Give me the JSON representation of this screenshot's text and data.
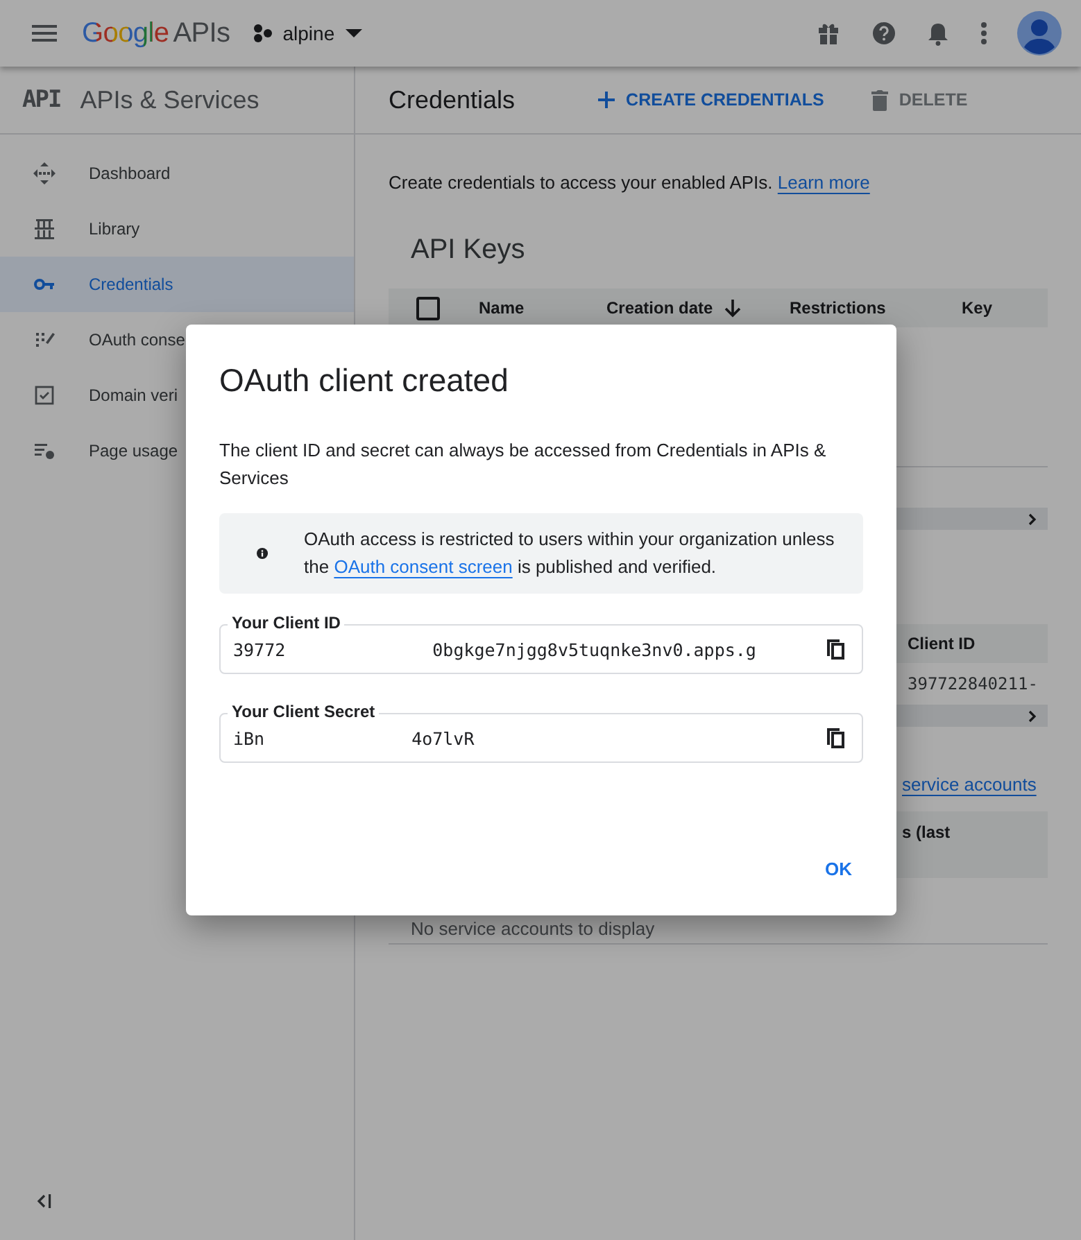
{
  "header": {
    "logo": {
      "letters": "Google",
      "suffix": "APIs"
    },
    "project": "alpine"
  },
  "subheader": {
    "product_mark": "API",
    "product": "APIs & Services",
    "page_title": "Credentials",
    "actions": [
      {
        "kind": "create",
        "label": "CREATE CREDENTIALS",
        "disabled": false
      },
      {
        "kind": "delete",
        "label": "DELETE",
        "disabled": true
      }
    ]
  },
  "sidebar": {
    "items": [
      {
        "kind": "dashboard",
        "label": "Dashboard",
        "selected": false
      },
      {
        "kind": "library",
        "label": "Library",
        "selected": false
      },
      {
        "kind": "key",
        "label": "Credentials",
        "selected": true
      },
      {
        "kind": "consent",
        "label": "OAuth conse",
        "selected": false
      },
      {
        "kind": "domain",
        "label": "Domain veri",
        "selected": false
      },
      {
        "kind": "usage",
        "label": "Page usage",
        "selected": false
      }
    ]
  },
  "main": {
    "intro": "Create credentials to access your enabled APIs.",
    "intro_link": "Learn more",
    "api_keys": {
      "title": "API Keys",
      "checked": false,
      "columns": [
        "Name",
        "Creation date",
        "Restrictions",
        "Key"
      ]
    },
    "oauth_table": {
      "column": "Client ID",
      "cell": "397722840211-"
    },
    "service_link": "service accounts",
    "service_column": "s (last",
    "empty": "No service accounts to display"
  },
  "dialog": {
    "title": "OAuth client created",
    "body": "The client ID and secret can always be accessed from Credentials in APIs & Services",
    "notice": {
      "before": "OAuth access is restricted to users within your organization unless the",
      "link": "OAuth consent screen",
      "after": "is published and verified."
    },
    "fields": [
      {
        "label": "Your Client ID",
        "value_start": "39772",
        "value_end": "0bgkge7njgg8v5tuqnke3nv0.apps.g"
      },
      {
        "label": "Your Client Secret",
        "value_start": "iBn",
        "value_end": "4o7lvR"
      }
    ],
    "button": "OK"
  }
}
